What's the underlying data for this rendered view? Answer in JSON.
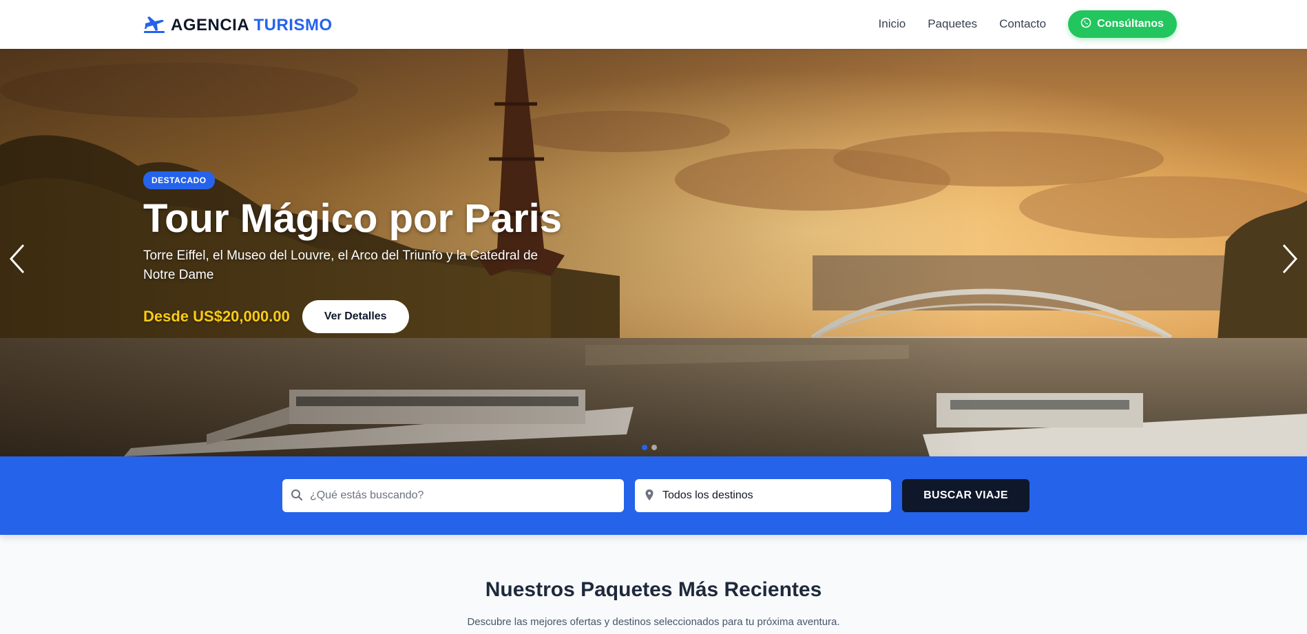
{
  "header": {
    "brand_main": "AGENCIA",
    "brand_accent": "TURISMO",
    "nav": [
      {
        "label": "Inicio"
      },
      {
        "label": "Paquetes"
      },
      {
        "label": "Contacto"
      }
    ],
    "cta_label": "Consúltanos"
  },
  "hero": {
    "badge": "DESTACADO",
    "title": "Tour Mágico por Paris",
    "description": "Torre Eiffel, el Museo del Louvre, el Arco del Triunfo y la Catedral de Notre Dame",
    "price": "Desde US$20,000.00",
    "details_label": "Ver Detalles",
    "slides_total": 2,
    "active_slide": 1
  },
  "search": {
    "placeholder": "¿Qué estás buscando?",
    "value": "",
    "destination_selected": "Todos los destinos",
    "button_label": "BUSCAR VIAJE"
  },
  "section": {
    "title": "Nuestros Paquetes Más Recientes",
    "subtitle": "Descubre las mejores ofertas y destinos seleccionados para tu próxima aventura."
  },
  "colors": {
    "primary": "#2563eb",
    "cta_green": "#22c55e",
    "dark": "#0f172a",
    "price_yellow": "#facc15"
  },
  "icons": {
    "logo": "airplane-icon",
    "cta": "whatsapp-icon",
    "search": "search-icon",
    "destination": "map-pin-icon",
    "prev": "chevron-left-icon",
    "next": "chevron-right-icon"
  }
}
